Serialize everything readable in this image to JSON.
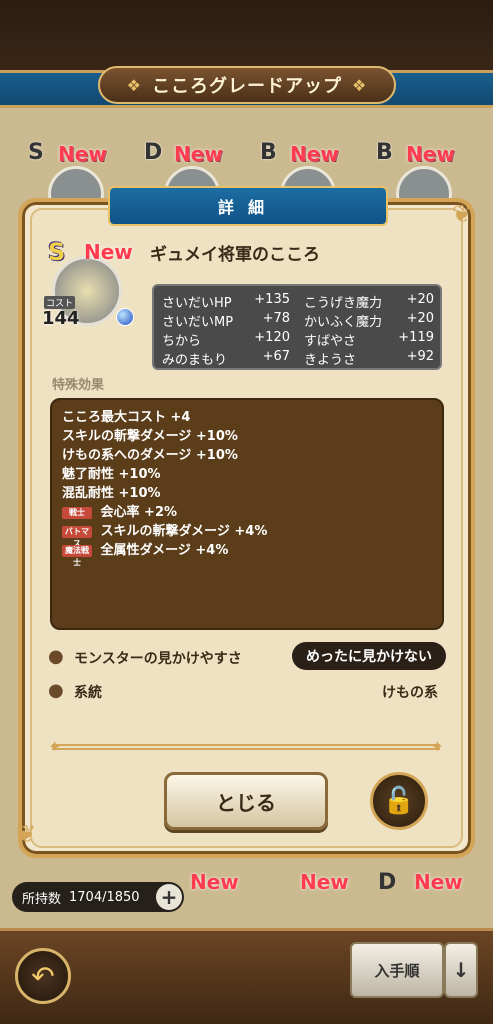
{
  "header": {
    "title": "こころグレードアップ"
  },
  "background_items": [
    {
      "rank": "S",
      "new": "New"
    },
    {
      "rank": "D",
      "new": "New"
    },
    {
      "rank": "B",
      "new": "New"
    },
    {
      "rank": "B",
      "new": "New"
    }
  ],
  "bottom_items": [
    {
      "new": "New"
    },
    {
      "new": "New"
    },
    {
      "rank": "D",
      "new": "New"
    }
  ],
  "dialog": {
    "banner": "詳細",
    "kokoro": {
      "rank": "S",
      "new": "New",
      "cost_label": "コスト",
      "cost": "144",
      "name": "ギュメイ将軍のこころ"
    },
    "stats": [
      {
        "name": "さいだいHP",
        "value": "+135"
      },
      {
        "name": "こうげき魔力",
        "value": "+20"
      },
      {
        "name": "さいだいMP",
        "value": "+78"
      },
      {
        "name": "かいふく魔力",
        "value": "+20"
      },
      {
        "name": "ちから",
        "value": "+120"
      },
      {
        "name": "すばやさ",
        "value": "+119"
      },
      {
        "name": "みのまもり",
        "value": "+67"
      },
      {
        "name": "きようさ",
        "value": "+92"
      }
    ],
    "special_label": "特殊効果",
    "effects": [
      {
        "tag": "",
        "text": "こころ最大コスト +4"
      },
      {
        "tag": "",
        "text": "スキルの斬撃ダメージ +10%"
      },
      {
        "tag": "",
        "text": "けもの系へのダメージ +10%"
      },
      {
        "tag": "",
        "text": "魅了耐性 +10%"
      },
      {
        "tag": "",
        "text": "混乱耐性 +10%"
      },
      {
        "tag": "戦士",
        "text": "会心率 +2%"
      },
      {
        "tag": "バトマス",
        "text": "スキルの斬撃ダメージ +4%"
      },
      {
        "tag": "魔法戦士",
        "text": "全属性ダメージ +4%"
      }
    ],
    "appearance": {
      "label": "モンスターの見かけやすさ",
      "value": "めったに見かけない"
    },
    "family": {
      "label": "系統",
      "value": "けもの系"
    },
    "close_label": "とじる"
  },
  "footer": {
    "possession_label": "所持数",
    "possession_value": "1704/1850",
    "sort_label": "入手順",
    "sort_direction": "↓",
    "back_icon": "back-arrow-icon"
  },
  "colors": {
    "accent_gold": "#d4a557",
    "banner_blue": "#1c6da3",
    "new_red": "#ff3b4f",
    "effects_bg": "#5b3d19"
  }
}
